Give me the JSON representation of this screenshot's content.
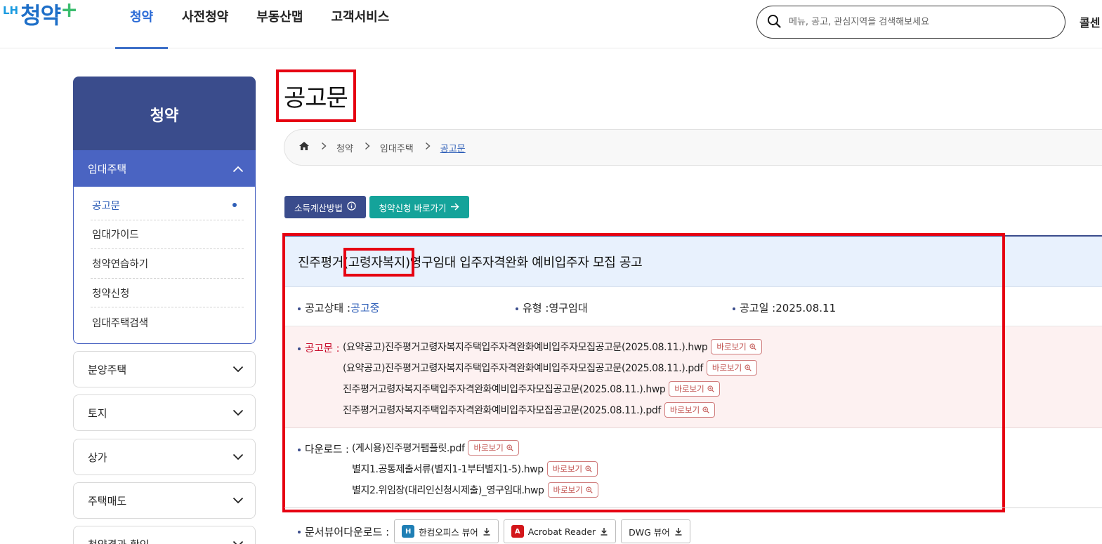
{
  "header": {
    "logo_lh": "LH",
    "logo_main": "청약",
    "logo_plus": "+",
    "nav": [
      {
        "label": "청약",
        "active": true
      },
      {
        "label": "사전청약",
        "active": false
      },
      {
        "label": "부동산맵",
        "active": false
      },
      {
        "label": "고객서비스",
        "active": false
      }
    ],
    "search_placeholder": "메뉴, 공고, 관심지역을 검색해보세요",
    "call_center": "콜센"
  },
  "sidebar": {
    "title": "청약",
    "active_section": "임대주택",
    "sub_items": [
      {
        "label": "공고문",
        "current": true
      },
      {
        "label": "임대가이드",
        "current": false
      },
      {
        "label": "청약연습하기",
        "current": false
      },
      {
        "label": "청약신청",
        "current": false
      },
      {
        "label": "임대주택검색",
        "current": false
      }
    ],
    "menus": [
      "분양주택",
      "토지",
      "상가",
      "주택매도",
      "청약결과 확인"
    ]
  },
  "main": {
    "page_title": "공고문",
    "breadcrumb": [
      "청약",
      "임대주택",
      "공고문"
    ],
    "btn_income": "소득계산방법",
    "btn_apply": "청약신청 바로가기",
    "notice": {
      "title_prefix": "진주평거",
      "title_highlight": "(고령자복지)",
      "title_suffix": " 영구임대 입주자격완화 예비입주자 모집 공고",
      "status_label": "공고상태 : ",
      "status_value": "공고중",
      "type_label": "유형 : ",
      "type_value": "영구임대",
      "date_label": "공고일 : ",
      "date_value": "2025.08.11",
      "notice_label": "공고문 :",
      "notice_files": [
        "(요약공고)진주평거고령자복지주택입주자격완화예비입주자모집공고문(2025.08.11.).hwp",
        "(요약공고)진주평거고령자복지주택입주자격완화예비입주자모집공고문(2025.08.11.).pdf",
        "진주평거고령자복지주택입주자격완화예비입주자모집공고문(2025.08.11.).hwp",
        "진주평거고령자복지주택입주자격완화예비입주자모집공고문(2025.08.11.).pdf"
      ],
      "download_label": "다운로드 :",
      "download_files": [
        "(게시용)진주평거팸플릿.pdf",
        "별지1.공통제출서류(별지1-1부터별지1-5).hwp",
        "별지2.위임장(대리인신청시제출)_영구임대.hwp"
      ],
      "view_btn": "바로보기"
    },
    "viewer_label": "문서뷰어다운로드 :",
    "viewers": [
      "한컴오피스 뷰어",
      "Acrobat Reader",
      "DWG 뷰어"
    ]
  },
  "colors": {
    "brand_navy": "#3a4c8c",
    "brand_blue": "#4a64c2",
    "teal": "#14a39a",
    "highlight_red": "#e60012"
  }
}
